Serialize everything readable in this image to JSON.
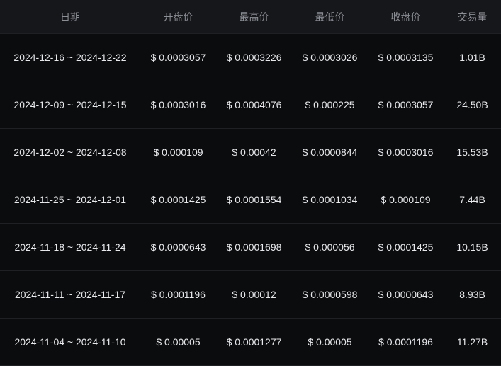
{
  "table": {
    "headers": {
      "date": "日期",
      "open": "开盘价",
      "high": "最高价",
      "low": "最低价",
      "close": "收盘价",
      "volume": "交易量"
    },
    "rows": [
      {
        "date": "2024-12-16 ~ 2024-12-22",
        "open": "$ 0.0003057",
        "high": "$ 0.0003226",
        "low": "$ 0.0003026",
        "close": "$ 0.0003135",
        "volume": "1.01B"
      },
      {
        "date": "2024-12-09 ~ 2024-12-15",
        "open": "$ 0.0003016",
        "high": "$ 0.0004076",
        "low": "$ 0.000225",
        "close": "$ 0.0003057",
        "volume": "24.50B"
      },
      {
        "date": "2024-12-02 ~ 2024-12-08",
        "open": "$ 0.000109",
        "high": "$ 0.00042",
        "low": "$ 0.0000844",
        "close": "$ 0.0003016",
        "volume": "15.53B"
      },
      {
        "date": "2024-11-25 ~ 2024-12-01",
        "open": "$ 0.0001425",
        "high": "$ 0.0001554",
        "low": "$ 0.0001034",
        "close": "$ 0.000109",
        "volume": "7.44B"
      },
      {
        "date": "2024-11-18 ~ 2024-11-24",
        "open": "$ 0.0000643",
        "high": "$ 0.0001698",
        "low": "$ 0.000056",
        "close": "$ 0.0001425",
        "volume": "10.15B"
      },
      {
        "date": "2024-11-11 ~ 2024-11-17",
        "open": "$ 0.0001196",
        "high": "$ 0.00012",
        "low": "$ 0.0000598",
        "close": "$ 0.0000643",
        "volume": "8.93B"
      },
      {
        "date": "2024-11-04 ~ 2024-11-10",
        "open": "$ 0.00005",
        "high": "$ 0.0001277",
        "low": "$ 0.00005",
        "close": "$ 0.0001196",
        "volume": "11.27B"
      }
    ]
  }
}
